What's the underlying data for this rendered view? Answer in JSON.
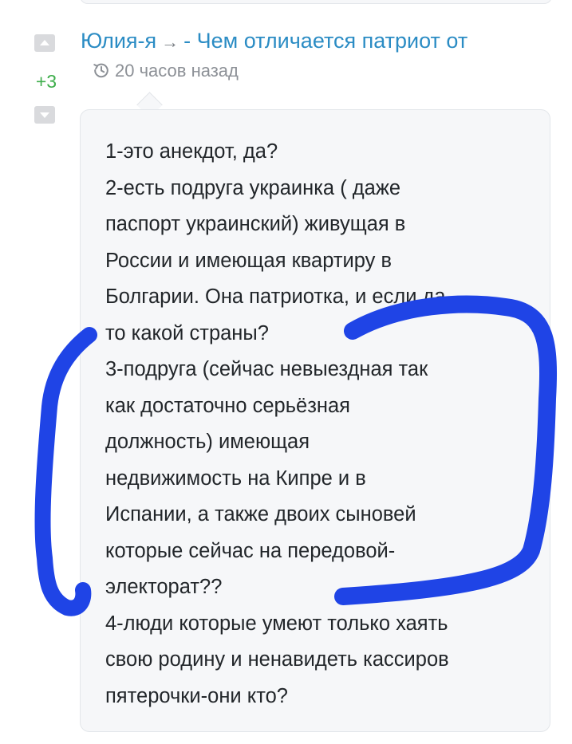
{
  "comment": {
    "author": "Юлия-я",
    "reply_arrow": "→",
    "thread_title": "- Чем отличается патриот от",
    "time_ago": "20 часов назад",
    "score": "+3",
    "body_lines": [
      "1-это анекдот, да?",
      "2-есть подруга украинка ( даже",
      "паспорт украинский) живущая в",
      "России и имеющая квартиру в",
      "Болгарии. Она патриотка, и если да",
      "то какой страны?",
      "3-подруга (сейчас невыездная так",
      "как достаточно серьёзная",
      "должность) имеющая",
      "недвижимость на Кипре и в",
      "Испании, а также двоих сыновей",
      "которые сейчас на передовой-",
      "электорат??",
      "4-люди которые умеют только хаять",
      "свою родину и ненавидеть кассиров",
      "пятерочки-они кто?"
    ]
  },
  "colors": {
    "link": "#2b8cc4",
    "score_positive": "#3fae4c",
    "meta_text": "#8c9096",
    "body_text": "#22262a",
    "card_bg": "#f6f7f9",
    "vote_button": "#d9dadd",
    "annotation_marker": "#1f44e6"
  },
  "icons": {
    "vote_up": "triangle-up-icon",
    "vote_down": "triangle-down-icon",
    "timestamp": "history-icon"
  }
}
